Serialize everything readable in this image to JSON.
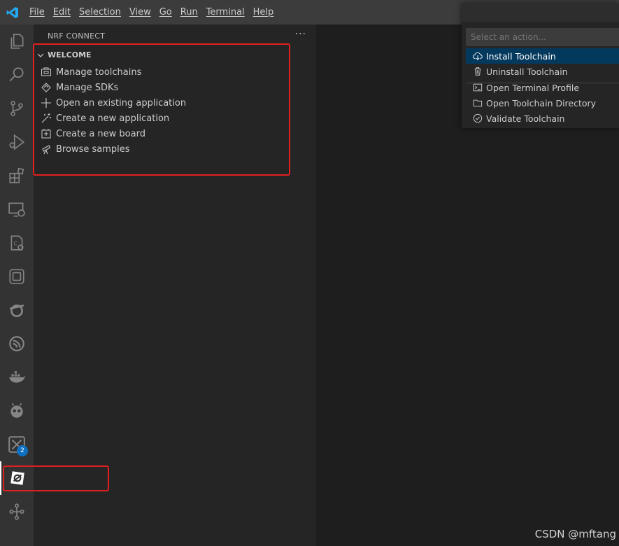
{
  "menu": [
    "File",
    "Edit",
    "Selection",
    "View",
    "Go",
    "Run",
    "Terminal",
    "Help"
  ],
  "activity_bar": {
    "items": [
      "explorer-icon",
      "search-icon",
      "source-control-icon",
      "run-debug-icon",
      "extensions-icon",
      "remote-explorer-icon",
      "cmake-icon",
      "chip-icon",
      "openshift-icon",
      "espressif-icon",
      "docker-icon",
      "platformio-icon",
      "xilinx-icon",
      "nrf-connect-icon",
      "tree-icon"
    ],
    "badge": "2"
  },
  "sidebar": {
    "title": "NRF CONNECT",
    "more": "···",
    "section": "WELCOME",
    "items": [
      {
        "label": "Manage toolchains",
        "icon": "toolchain-icon"
      },
      {
        "label": "Manage SDKs",
        "icon": "sdk-icon"
      },
      {
        "label": "Open an existing application",
        "icon": "plus-icon"
      },
      {
        "label": "Create a new application",
        "icon": "wand-icon"
      },
      {
        "label": "Create a new board",
        "icon": "board-icon"
      },
      {
        "label": "Browse samples",
        "icon": "telescope-icon"
      }
    ]
  },
  "quickpick": {
    "placeholder": "Select an action...",
    "items": [
      {
        "label": "Install Toolchain",
        "icon": "cloud-download-icon"
      },
      {
        "label": "Uninstall Toolchain",
        "icon": "trash-icon"
      },
      {
        "label": "Open Terminal Profile",
        "icon": "terminal-icon"
      },
      {
        "label": "Open Toolchain Directory",
        "icon": "folder-icon"
      },
      {
        "label": "Validate Toolchain",
        "icon": "check-circle-icon"
      }
    ]
  },
  "watermark": "CSDN @mftang",
  "colors": {
    "highlight": "#e02020",
    "selected": "#04395e",
    "accent": "#007acc"
  }
}
